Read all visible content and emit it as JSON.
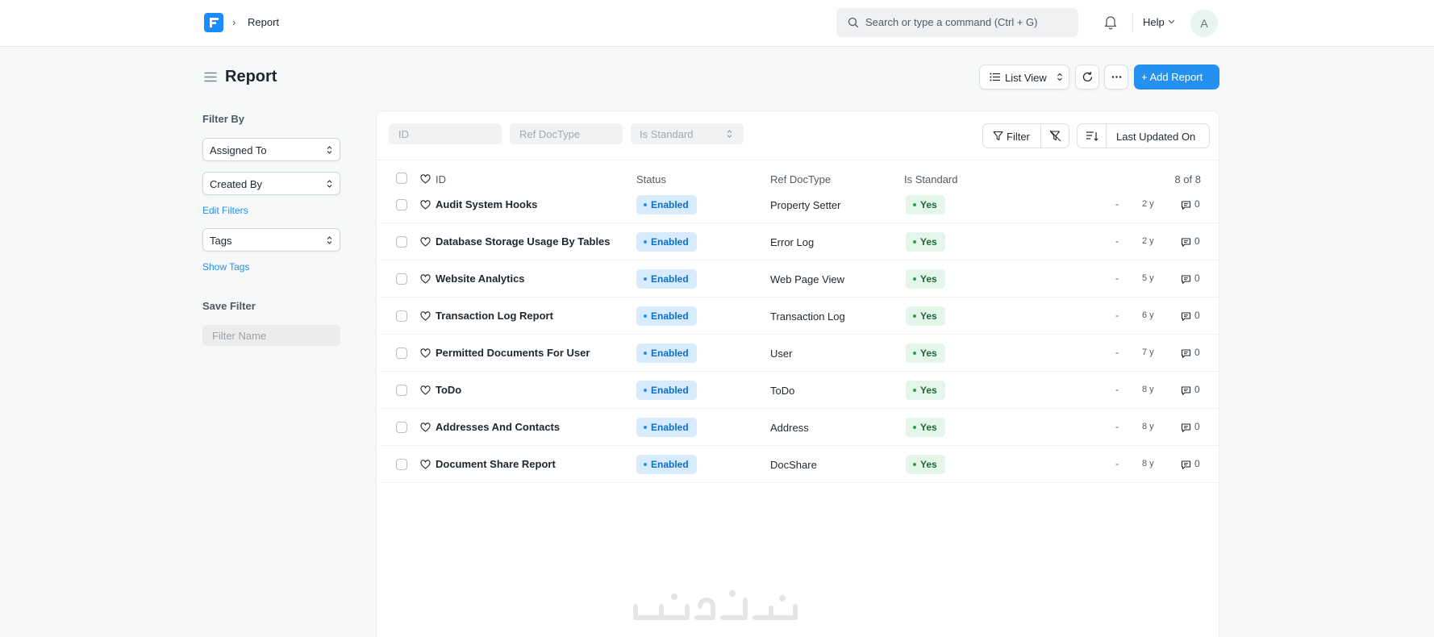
{
  "navbar": {
    "breadcrumb": "Report",
    "search_placeholder": "Search or type a command (Ctrl + G)",
    "help_label": "Help",
    "avatar_initial": "A"
  },
  "page": {
    "title": "Report",
    "view_label": "List View",
    "add_label": "+ Add Report"
  },
  "sidebar": {
    "filter_by": "Filter By",
    "assigned_to": "Assigned To",
    "created_by": "Created By",
    "edit_filters": "Edit Filters",
    "tags": "Tags",
    "show_tags": "Show Tags",
    "save_filter": "Save Filter",
    "filter_name_placeholder": "Filter Name"
  },
  "filters": {
    "id_placeholder": "ID",
    "ref_doctype_placeholder": "Ref DocType",
    "is_standard_label": "Is Standard",
    "filter_label": "Filter",
    "sort_label": "Last Updated On"
  },
  "table": {
    "columns": {
      "id": "ID",
      "status": "Status",
      "ref_doctype": "Ref DocType",
      "is_standard": "Is Standard"
    },
    "count": "8 of 8",
    "rows": [
      {
        "id": "Audit System Hooks",
        "status": "Enabled",
        "ref": "Property Setter",
        "std": "Yes",
        "modified": "-",
        "age": "2 y",
        "comments": "0"
      },
      {
        "id": "Database Storage Usage By Tables",
        "status": "Enabled",
        "ref": "Error Log",
        "std": "Yes",
        "modified": "-",
        "age": "2 y",
        "comments": "0"
      },
      {
        "id": "Website Analytics",
        "status": "Enabled",
        "ref": "Web Page View",
        "std": "Yes",
        "modified": "-",
        "age": "5 y",
        "comments": "0"
      },
      {
        "id": "Transaction Log Report",
        "status": "Enabled",
        "ref": "Transaction Log",
        "std": "Yes",
        "modified": "-",
        "age": "6 y",
        "comments": "0"
      },
      {
        "id": "Permitted Documents For User",
        "status": "Enabled",
        "ref": "User",
        "std": "Yes",
        "modified": "-",
        "age": "7 y",
        "comments": "0"
      },
      {
        "id": "ToDo",
        "status": "Enabled",
        "ref": "ToDo",
        "std": "Yes",
        "modified": "-",
        "age": "8 y",
        "comments": "0"
      },
      {
        "id": "Addresses And Contacts",
        "status": "Enabled",
        "ref": "Address",
        "std": "Yes",
        "modified": "-",
        "age": "8 y",
        "comments": "0"
      },
      {
        "id": "Document Share Report",
        "status": "Enabled",
        "ref": "DocShare",
        "std": "Yes",
        "modified": "-",
        "age": "8 y",
        "comments": "0"
      }
    ]
  },
  "colors": {
    "primary": "#2490ef",
    "status_bg": "#d7ebfc",
    "yes_bg": "#e4f5e9"
  }
}
